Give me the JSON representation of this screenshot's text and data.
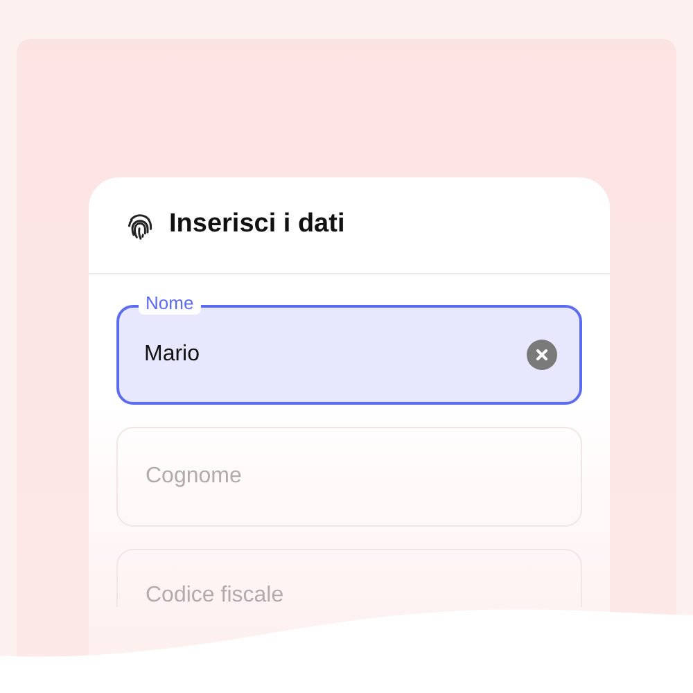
{
  "card": {
    "title": "Inserisci i dati"
  },
  "fields": [
    {
      "label": "Nome",
      "value": "Mario",
      "focused": true
    },
    {
      "placeholder": "Cognome",
      "focused": false
    },
    {
      "placeholder": "Codice fiscale",
      "focused": false
    }
  ]
}
